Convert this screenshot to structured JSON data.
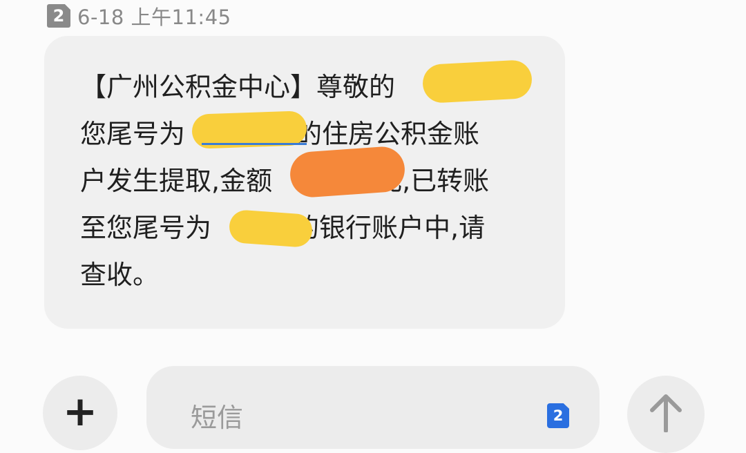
{
  "header": {
    "sim_slot": "2",
    "timestamp": "6-18 上午11:45"
  },
  "message": {
    "line1": "【广州公积金中心】尊敬的",
    "line2": "您尾号为",
    "line2b": "的住房公积金账",
    "line3": "户发生提取,金额",
    "line3b": "元,已转账",
    "line4": "至您尾号为",
    "line4b": "的银行账户中,请",
    "line5": "查收。"
  },
  "colors": {
    "redact_yellow": "#f9cf3c",
    "redact_orange": "#f5883a",
    "link_blue": "#3a7bd5"
  },
  "composer": {
    "plus_label": "+",
    "placeholder": "短信",
    "sim_slot": "2"
  },
  "icons": {
    "plus": "plus-icon",
    "send": "arrow-up-icon",
    "sim": "sim-card-icon"
  }
}
